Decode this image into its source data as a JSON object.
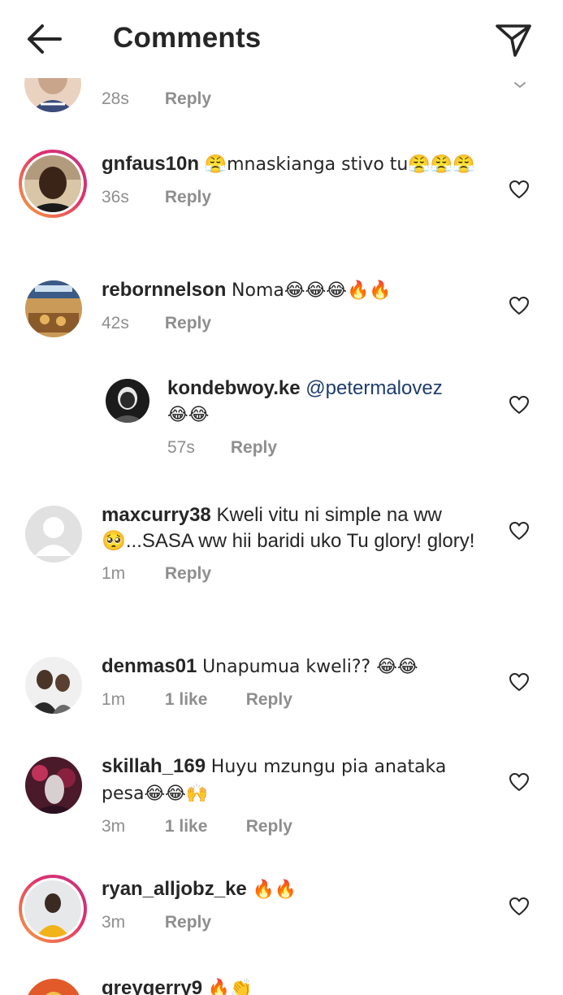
{
  "header": {
    "title": "Comments",
    "back_icon": "arrow-left-icon",
    "share_icon": "send-icon"
  },
  "comments": [
    {
      "time": "28s",
      "reply_label": "Reply"
    },
    {
      "username": "gnfaus10n",
      "text": "😤mnaskianga stivo tu😤😤😤",
      "time": "36s",
      "reply_label": "Reply"
    },
    {
      "username": "rebornnelson",
      "text": "Noma😂😂😂🔥🔥",
      "time": "42s",
      "reply_label": "Reply"
    },
    {
      "username": "kondebwoy.ke",
      "mention": "@petermalovez",
      "text": "😂😂",
      "time": "57s",
      "reply_label": "Reply"
    },
    {
      "username": "maxcurry38",
      "text": "Kweli vitu ni simple na ww 🥺...SASA ww hii baridi uko Tu glory! glory!",
      "time": "1m",
      "reply_label": "Reply"
    },
    {
      "username": "denmas01",
      "text": "Unapumua kweli?? 😂😂",
      "time": "1m",
      "likes": "1 like",
      "reply_label": "Reply"
    },
    {
      "username": "skillah_169",
      "text": "Huyu mzungu pia anataka pesa😂😂🙌",
      "time": "3m",
      "likes": "1 like",
      "reply_label": "Reply"
    },
    {
      "username": "ryan_alljobz_ke",
      "text": "🔥🔥",
      "time": "3m",
      "reply_label": "Reply"
    },
    {
      "username": "greygerry9",
      "text": "🔥👏"
    }
  ],
  "colors": {
    "text": "#262626",
    "muted": "#8e8e8e",
    "mention": "#1e3d6b",
    "story_ring_start": "#f9a23b",
    "story_ring_end": "#c13584"
  }
}
